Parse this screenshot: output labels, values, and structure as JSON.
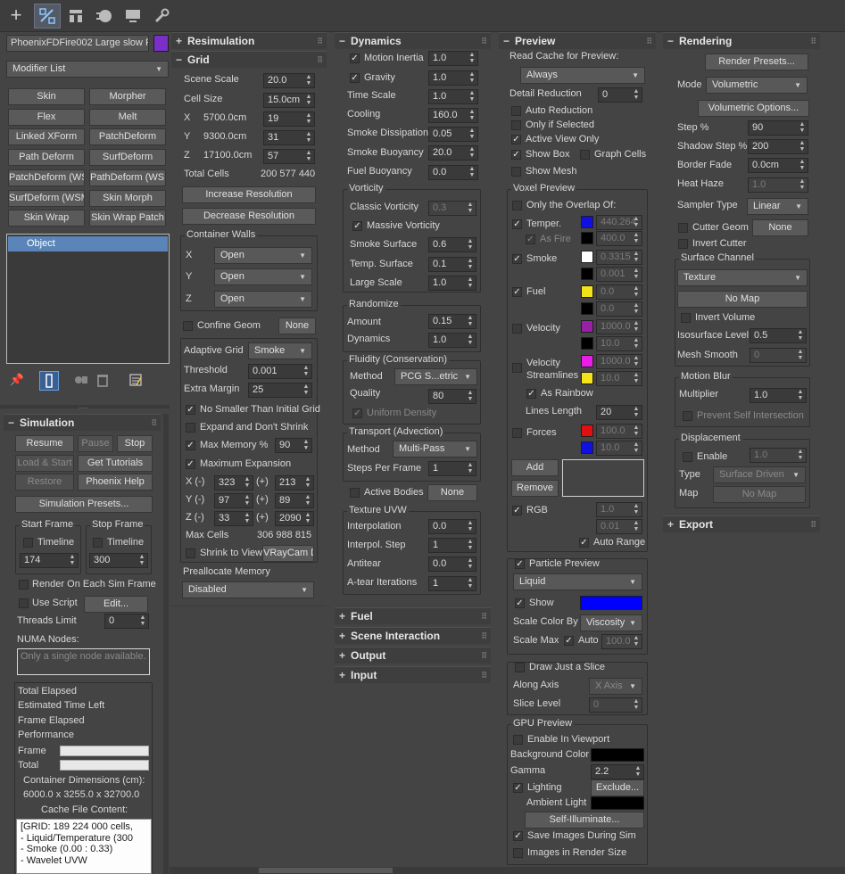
{
  "toolbar": {
    "tabs": [
      {
        "icon": "create-icon"
      },
      {
        "icon": "modify-icon"
      },
      {
        "icon": "hierarchy-icon"
      },
      {
        "icon": "motion-icon"
      },
      {
        "icon": "display-icon"
      },
      {
        "icon": "utilities-icon"
      }
    ]
  },
  "left": {
    "object_name": "PhoenixFDFire002 Large slow Pa",
    "object_color": "#7a2fc8",
    "modifier_list": "Modifier List",
    "modifier_buttons": [
      "Skin",
      "Morpher",
      "Flex",
      "Melt",
      "Linked XForm",
      "PatchDeform",
      "Path Deform",
      "SurfDeform",
      "PatchDeform (WSM",
      "PathDeform (WSM",
      "SurfDeform (WSM",
      "Skin Morph",
      "Skin Wrap",
      "Skin Wrap Patch"
    ],
    "stack_item": "Object",
    "simulation": {
      "title": "Simulation",
      "resume": "Resume",
      "pause": "Pause",
      "stop": "Stop",
      "load_start": "Load & Start",
      "get_tutorials": "Get Tutorials",
      "restore": "Restore",
      "phoenix_help": "Phoenix Help",
      "sim_presets": "Simulation Presets...",
      "start_frame": "Start Frame",
      "stop_frame": "Stop Frame",
      "timeline": "Timeline",
      "start_value": "174",
      "stop_value": "300",
      "render_each": "Render On Each Sim Frame",
      "use_script": "Use Script",
      "edit": "Edit...",
      "threads_limit": "Threads Limit",
      "threads_value": "0",
      "numa_nodes": "NUMA Nodes:",
      "numa_placeholder": "Only a single node available.",
      "total_elapsed": "Total Elapsed",
      "est_time_left": "Estimated Time Left",
      "frame_elapsed": "Frame Elapsed",
      "performance": "Performance",
      "frame": "Frame",
      "total": "Total",
      "container_dims_label": "Container Dimensions (cm):",
      "container_dims": "6000.0 x 3255.0 x 32700.0",
      "cache_content_label": "Cache File Content:",
      "cache_lines": [
        "[GRID: 189 224 000 cells,",
        "- Liquid/Temperature (300",
        "- Smoke (0.00 : 0.33)",
        "- Wavelet UVW"
      ]
    }
  },
  "grid": {
    "resim_title": "Resimulation",
    "grid_title": "Grid",
    "scene_scale": "Scene Scale",
    "scene_scale_v": "20.0",
    "cell_size": "Cell Size",
    "cell_size_v": "15.0cm",
    "x": "X",
    "x_size": "5700.0cm",
    "x_cells": "19",
    "y": "Y",
    "y_size": "9300.0cm",
    "y_cells": "31",
    "z": "Z",
    "z_size": "17100.0cm",
    "z_cells": "57",
    "total_cells": "Total Cells",
    "total_cells_v": "200 577 440",
    "inc_res": "Increase Resolution",
    "dec_res": "Decrease Resolution",
    "container_walls": "Container Walls",
    "walls": [
      {
        "axis": "X",
        "v": "Open"
      },
      {
        "axis": "Y",
        "v": "Open"
      },
      {
        "axis": "Z",
        "v": "Open"
      }
    ],
    "confine_geom": "Confine Geom",
    "none": "None",
    "adaptive_grid": "Adaptive Grid",
    "adaptive_v": "Smoke",
    "threshold": "Threshold",
    "threshold_v": "0.001",
    "extra_margin": "Extra Margin",
    "extra_margin_v": "25",
    "no_smaller": "No Smaller Than Initial Grid",
    "expand_shrink": "Expand and Don't Shrink",
    "max_memory": "Max Memory %",
    "max_memory_v": "90",
    "max_expansion": "Maximum Expansion",
    "exp": [
      {
        "a": "X (-)",
        "m": "323",
        "p": "213"
      },
      {
        "a": "Y (-)",
        "m": "97",
        "p": "89"
      },
      {
        "a": "Z (-)",
        "m": "33",
        "p": "2090"
      }
    ],
    "plus": "(+)",
    "max_cells": "Max Cells",
    "max_cells_v": "306 988 815",
    "shrink_view": "Shrink to View",
    "shrink_cam": "VRayCam D",
    "prealloc": "Preallocate Memory",
    "prealloc_v": "Disabled"
  },
  "dyn": {
    "title": "Dynamics",
    "motion_inertia": "Motion Inertia",
    "motion_inertia_v": "1.0",
    "gravity": "Gravity",
    "gravity_v": "1.0",
    "time_scale": "Time Scale",
    "time_scale_v": "1.0",
    "cooling": "Cooling",
    "cooling_v": "160.0",
    "smoke_diss": "Smoke Dissipation",
    "smoke_diss_v": "0.05",
    "smoke_buoy": "Smoke Buoyancy",
    "smoke_buoy_v": "20.0",
    "fuel_buoy": "Fuel Buoyancy",
    "fuel_buoy_v": "0.0",
    "vorticity": "Vorticity",
    "classic_vort": "Classic Vorticity",
    "classic_vort_v": "0.3",
    "massive_vort": "Massive Vorticity",
    "smoke_surface": "Smoke Surface",
    "smoke_surface_v": "0.6",
    "temp_surface": "Temp. Surface",
    "temp_surface_v": "0.1",
    "large_scale": "Large Scale",
    "large_scale_v": "1.0",
    "randomize": "Randomize",
    "amount": "Amount",
    "amount_v": "0.15",
    "dynamics": "Dynamics",
    "dynamics_v": "1.0",
    "fluidity": "Fluidity (Conservation)",
    "method": "Method",
    "method_v": "PCG S...etric",
    "quality": "Quality",
    "quality_v": "80",
    "uniform_density": "Uniform Density",
    "transport": "Transport (Advection)",
    "t_method_v": "Multi-Pass",
    "steps_per_frame": "Steps Per Frame",
    "steps_v": "1",
    "active_bodies": "Active Bodies",
    "none": "None",
    "texture_uvw": "Texture UVW",
    "interpolation": "Interpolation",
    "interp_v": "0.0",
    "interp_step": "Interpol. Step",
    "interp_step_v": "1",
    "antitear": "Antitear",
    "antitear_v": "0.0",
    "atear_iter": "A-tear Iterations",
    "atear_iter_v": "1",
    "fuel": "Fuel",
    "scene_inter": "Scene Interaction",
    "output": "Output",
    "input": "Input"
  },
  "preview": {
    "title": "Preview",
    "read_cache": "Read Cache for Preview:",
    "read_cache_v": "Always",
    "detail_red": "Detail Reduction",
    "detail_red_v": "0",
    "auto_red": "Auto Reduction",
    "only_selected": "Only if Selected",
    "active_view": "Active View Only",
    "show_box": "Show Box",
    "graph_cells": "Graph Cells",
    "show_mesh": "Show Mesh",
    "voxel_preview": "Voxel Preview",
    "only_overlap": "Only the Overlap Of:",
    "temper": "Temper.",
    "temper_v": "440.264",
    "as_fire": "As Fire",
    "as_fire_v": "400.0",
    "smoke": "Smoke",
    "smoke_v": "0.3315",
    "smoke_v2": "0.001",
    "fuel": "Fuel",
    "fuel_v": "0.0",
    "fuel_v2": "0.0",
    "velocity": "Velocity",
    "vel_v": "1000.0",
    "vel_v2": "10.0",
    "vel_stream": "Velocity",
    "vel_stream2": "Streamlines",
    "vs_v": "1000.0",
    "vs_v2": "10.0",
    "as_rainbow": "As Rainbow",
    "lines_length": "Lines Length",
    "lines_length_v": "20",
    "forces": "Forces",
    "forces_v": "100.0",
    "forces_v2": "10.0",
    "add": "Add",
    "remove": "Remove",
    "rgb": "RGB",
    "rgb_v": "1.0",
    "rgb_v2": "0.01",
    "auto_range": "Auto Range",
    "particle_preview": "Particle Preview",
    "particle_v": "Liquid",
    "show": "Show",
    "scale_color_by": "Scale Color By",
    "scale_color_v": "Viscosity",
    "scale_max": "Scale Max",
    "auto": "Auto",
    "scale_max_v": "100.0",
    "draw_slice": "Draw Just a Slice",
    "along_axis": "Along Axis",
    "along_axis_v": "X Axis",
    "slice_level": "Slice Level",
    "slice_level_v": "0",
    "gpu_preview": "GPU Preview",
    "enable_viewport": "Enable In Viewport",
    "bg_color": "Background Color",
    "gamma": "Gamma",
    "gamma_v": "2.2",
    "lighting": "Lighting",
    "exclude": "Exclude...",
    "ambient": "Ambient Light",
    "self_illum": "Self-Illuminate...",
    "save_images": "Save Images During Sim",
    "images_render": "Images in Render Size",
    "colors": {
      "temper": "#1010e0",
      "asfire": "#000000",
      "smoke1": "#ffffff",
      "smoke2": "#000000",
      "fuel1": "#f5e31a",
      "fuel2": "#000000",
      "vel1": "#9a1fa8",
      "vel2": "#000000",
      "vs1": "#e81ee8",
      "vs2": "#f5e31a",
      "forces1": "#e01010",
      "forces2": "#1010e0",
      "show": "#0000ff",
      "bg": "#000000",
      "ambient": "#000000"
    }
  },
  "render": {
    "title": "Rendering",
    "presets": "Render Presets...",
    "mode": "Mode",
    "mode_v": "Volumetric",
    "vol_options": "Volumetric Options...",
    "step": "Step %",
    "step_v": "90",
    "shadow_step": "Shadow Step %",
    "shadow_step_v": "200",
    "border_fade": "Border Fade",
    "border_fade_v": "0.0cm",
    "heat_haze": "Heat Haze",
    "heat_haze_v": "1.0",
    "sampler": "Sampler Type",
    "sampler_v": "Linear",
    "cutter_geom": "Cutter Geom",
    "none": "None",
    "invert_cutter": "Invert Cutter",
    "surface_channel": "Surface Channel",
    "surface_v": "Texture",
    "no_map": "No Map",
    "invert_volume": "Invert Volume",
    "iso_level": "Isosurface Level",
    "iso_level_v": "0.5",
    "mesh_smooth": "Mesh Smooth",
    "mesh_smooth_v": "0",
    "motion_blur": "Motion Blur",
    "multiplier": "Multiplier",
    "multiplier_v": "1.0",
    "prevent_self": "Prevent Self Intersection",
    "displacement": "Displacement",
    "enable": "Enable",
    "disp_v": "1.0",
    "type": "Type",
    "type_v": "Surface Driven",
    "map": "Map",
    "map_v": "No Map",
    "export": "Export"
  }
}
